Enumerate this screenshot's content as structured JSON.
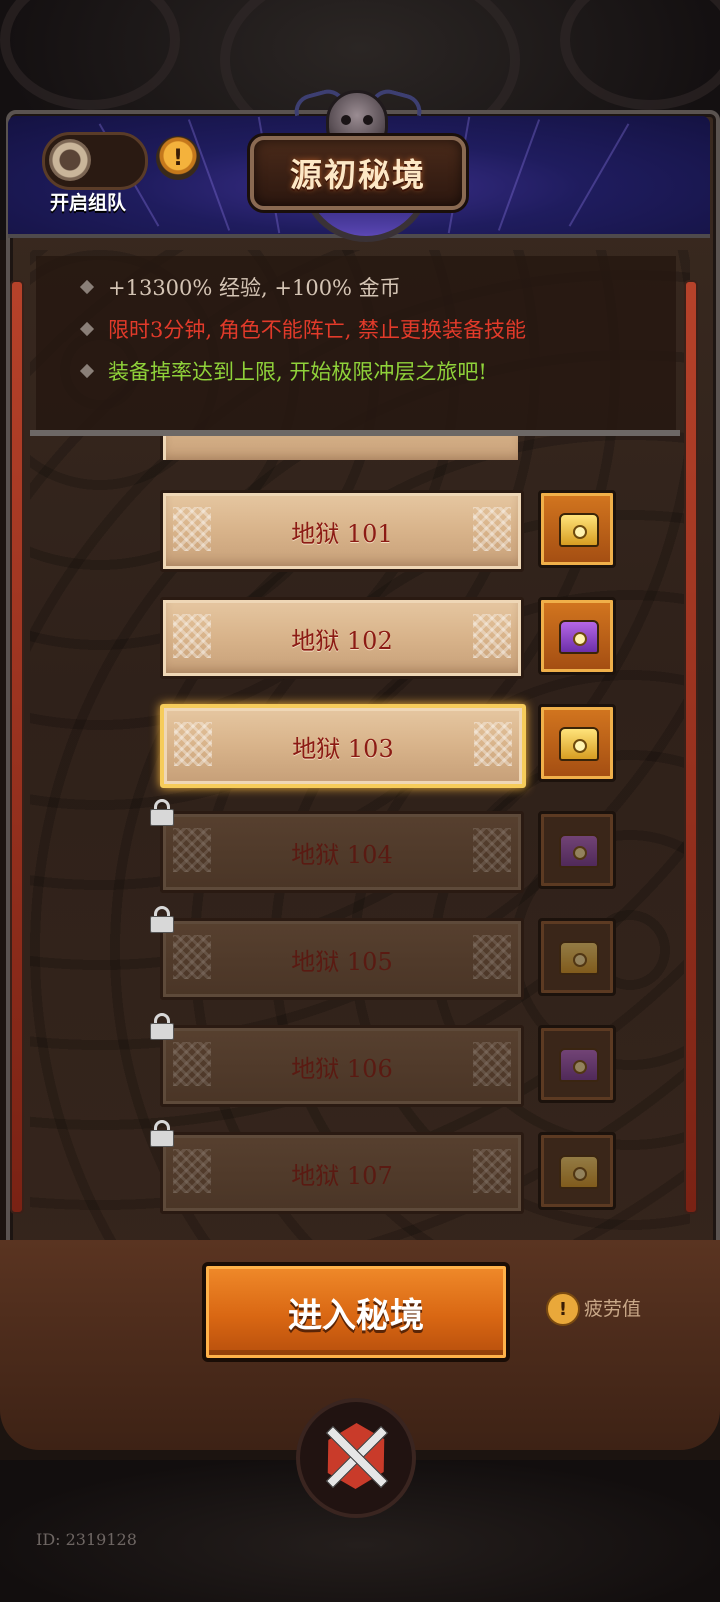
{
  "header": {
    "title": "源初秘境",
    "team_toggle_label": "开启组队"
  },
  "info": {
    "lines": [
      {
        "text": "+13300% 经验, +100% 金币",
        "color": "#d4c4b4"
      },
      {
        "text": "限时3分钟, 角色不能阵亡, 禁止更换装备技能",
        "color": "#e23a2a"
      },
      {
        "text": "装备掉率达到上限, 开始极限冲层之旅吧!",
        "color": "#8fd23a"
      }
    ]
  },
  "levels": [
    {
      "label": "地狱 101",
      "chest": "gold",
      "state": "unlocked"
    },
    {
      "label": "地狱 102",
      "chest": "purple",
      "state": "unlocked"
    },
    {
      "label": "地狱 103",
      "chest": "gold",
      "state": "selected"
    },
    {
      "label": "地狱 104",
      "chest": "purple",
      "state": "locked"
    },
    {
      "label": "地狱 105",
      "chest": "gold",
      "state": "locked"
    },
    {
      "label": "地狱 106",
      "chest": "purple",
      "state": "locked"
    },
    {
      "label": "地狱 107",
      "chest": "gold",
      "state": "locked"
    }
  ],
  "footer": {
    "enter_label": "进入秘境",
    "fatigue_label": "疲劳值",
    "id_text": "ID: 2319128"
  },
  "colors": {
    "accent": "#d96713",
    "plaque_text": "#8c1b14",
    "selected_border": "#f6cc5a"
  }
}
